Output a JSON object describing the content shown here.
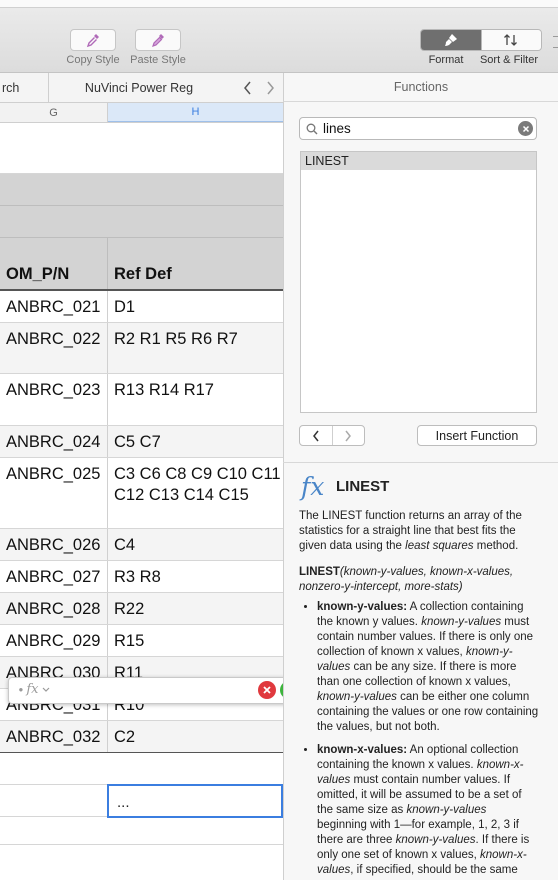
{
  "toolbar": {
    "copy_style": "Copy Style",
    "paste_style": "Paste Style",
    "format": "Format",
    "sort_filter": "Sort & Filter"
  },
  "tabs": {
    "left_partial": "rch",
    "active": "NuVinci Power Reg"
  },
  "columns": {
    "g": "G",
    "h": "H"
  },
  "header_row": {
    "g": "OM_P/N",
    "h": "Ref Def"
  },
  "rows": [
    {
      "g": "ANBRC_021",
      "h": "D1"
    },
    {
      "g": "ANBRC_022",
      "h": "R2 R1 R5 R6 R7"
    },
    {
      "g": "ANBRC_023",
      "h": "R13 R14 R17"
    },
    {
      "g": "ANBRC_024",
      "h": "C5 C7"
    },
    {
      "g": "ANBRC_025",
      "h": "C3 C6 C8 C9 C10 C11 C12 C13 C14 C15"
    },
    {
      "g": "ANBRC_026",
      "h": "C4"
    },
    {
      "g": "ANBRC_027",
      "h": "R3 R8"
    },
    {
      "g": "ANBRC_028",
      "h": "R22"
    },
    {
      "g": "ANBRC_029",
      "h": "R15"
    },
    {
      "g": "ANBRC_030",
      "h": "R11"
    },
    {
      "g": "ANBRC_031",
      "h": "R10"
    },
    {
      "g": "ANBRC_032",
      "h": "C2"
    }
  ],
  "editing_cell": "...",
  "formula_bar": {
    "fx": "fx"
  },
  "panel": {
    "title": "Functions",
    "search_value": "lines",
    "results": [
      "LINEST"
    ],
    "insert_button": "Insert Function",
    "function_name": "LINEST",
    "fx_glyph": "fx",
    "description_pre": "The LINEST function returns an array of the statistics for a straight line that best fits the given data using the ",
    "description_em": "least squares",
    "description_post": " method.",
    "syntax_name": "LINEST",
    "syntax_args": "(known-y-values, known-x-values, nonzero-y-intercept, more-stats)",
    "args": [
      {
        "name": "known-y-values:",
        "parts": [
          {
            "t": " A collection containing the known y values. "
          },
          {
            "i": "known-y-values"
          },
          {
            "t": " must contain number values. If there is only one collection of known x values, "
          },
          {
            "i": "known-y-values"
          },
          {
            "t": " can be any size. If there is more than one collection of known x values, "
          },
          {
            "i": "known-y-values"
          },
          {
            "t": " can be either one column containing the values or one row containing the values, but not both."
          }
        ]
      },
      {
        "name": "known-x-values:",
        "parts": [
          {
            "t": " An optional collection containing the known x values. "
          },
          {
            "i": "known-x-values"
          },
          {
            "t": " must contain number values. If omitted, it will be assumed to be a set of the same size as "
          },
          {
            "i": "known-y-values"
          },
          {
            "t": " beginning with 1—for example, 1, 2, 3 if there are three "
          },
          {
            "i": "known-y-values"
          },
          {
            "t": ". If there is only one set of known x values, "
          },
          {
            "i": "known-x-values"
          },
          {
            "t": ", if specified, should be the same"
          }
        ]
      }
    ]
  },
  "colors": {
    "accent_blue": "#3b7ee0",
    "cancel_red": "#e0393e",
    "accept_green": "#3cb43c",
    "header_gray": "#d3d3d3",
    "active_format": "#6f6f6f"
  }
}
